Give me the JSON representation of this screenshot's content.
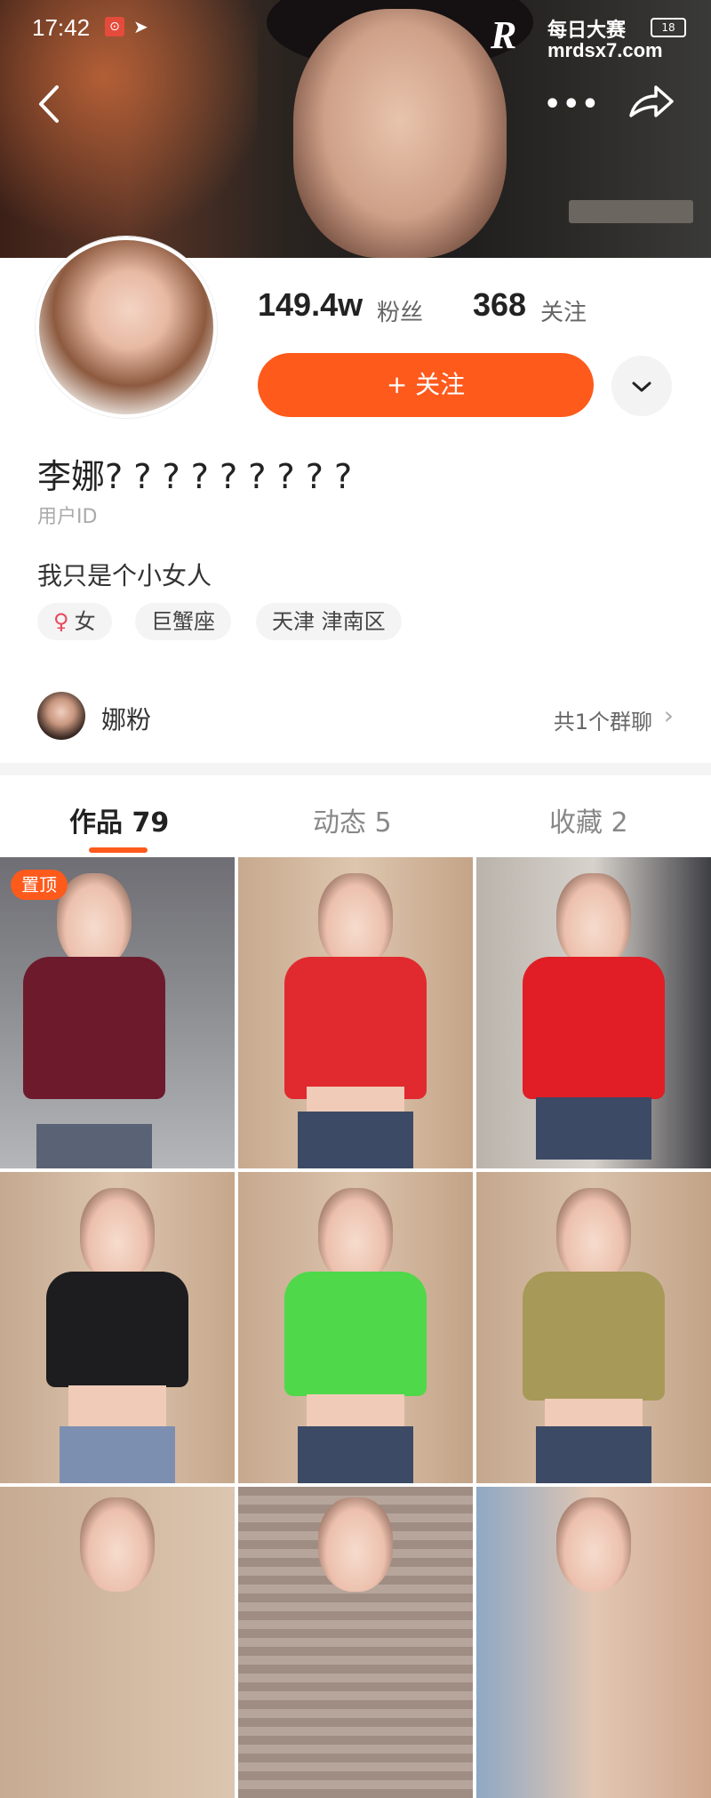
{
  "status": {
    "time": "17:42",
    "battery": "18"
  },
  "watermark": {
    "logo": "R",
    "top": "每日大赛",
    "url": "mrdsx7.com"
  },
  "nav": {
    "back_icon": "back-arrow-icon",
    "more_icon": "more-dots-icon",
    "share_icon": "share-icon"
  },
  "profile": {
    "fans_count": "149.4w",
    "fans_label": "粉丝",
    "following_count": "368",
    "following_label": "关注",
    "follow_button": "+ 关注",
    "name": "李娜? ? ? ? ? ? ? ? ?",
    "uid": "用户ID",
    "bio": "我只是个小女人",
    "tags": [
      {
        "icon": "♀",
        "label": "女"
      },
      {
        "label": "巨蟹座"
      },
      {
        "label": "天津 津南区"
      }
    ]
  },
  "group": {
    "name": "娜粉",
    "count": "共1个群聊"
  },
  "tabs": [
    {
      "label": "作品 79",
      "active": true
    },
    {
      "label": "动态 5",
      "active": false
    },
    {
      "label": "收藏 2",
      "active": false
    }
  ],
  "grid": {
    "pinned_label": "置顶"
  },
  "colors": {
    "accent": "#fe5a1c"
  }
}
